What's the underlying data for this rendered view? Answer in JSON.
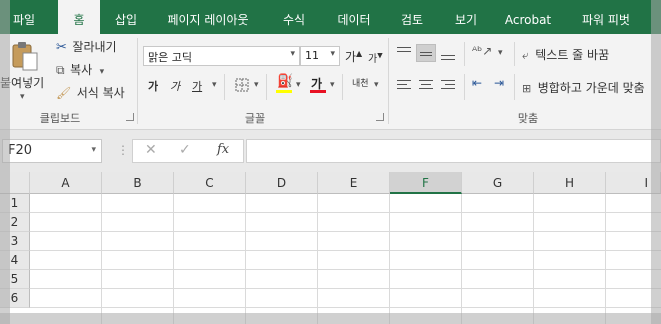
{
  "tabs": [
    {
      "label": "파일"
    },
    {
      "label": "홈"
    },
    {
      "label": "삽입"
    },
    {
      "label": "페이지 레이아웃"
    },
    {
      "label": "수식"
    },
    {
      "label": "데이터"
    },
    {
      "label": "검토"
    },
    {
      "label": "보기"
    },
    {
      "label": "Acrobat"
    },
    {
      "label": "파워 피벗"
    }
  ],
  "active_tab": "홈",
  "clipboard": {
    "paste_label": "붙여넣기",
    "cut_label": "잘라내기",
    "copy_label": "복사",
    "format_painter_label": "서식 복사",
    "group_label": "클립보드"
  },
  "font": {
    "font_name": "맑은 고딕",
    "font_size": "11",
    "grow_label": "가",
    "shrink_label": "가",
    "bold_label": "가",
    "italic_label": "가",
    "underline_label": "가",
    "font_color_label": "가",
    "phonetic_label": "내천",
    "group_label": "글꼴",
    "accent_color": "#e81123"
  },
  "alignment": {
    "wrap_text_label": "텍스트 줄 바꿈",
    "merge_label": "병합하고 가운데 맞춤",
    "group_label": "맞춤"
  },
  "formula_bar": {
    "name_box": "F20",
    "cancel_icon": "✕",
    "enter_icon": "✓",
    "fx_label": "fx",
    "formula_value": ""
  },
  "grid": {
    "columns": [
      "A",
      "B",
      "C",
      "D",
      "E",
      "F",
      "G",
      "H",
      "I"
    ],
    "rows": [
      "1",
      "2",
      "3",
      "4",
      "5",
      "6"
    ],
    "selected_column": "F"
  },
  "colors": {
    "brand": "#217346",
    "ribbon_bg": "#f3f3f3"
  }
}
